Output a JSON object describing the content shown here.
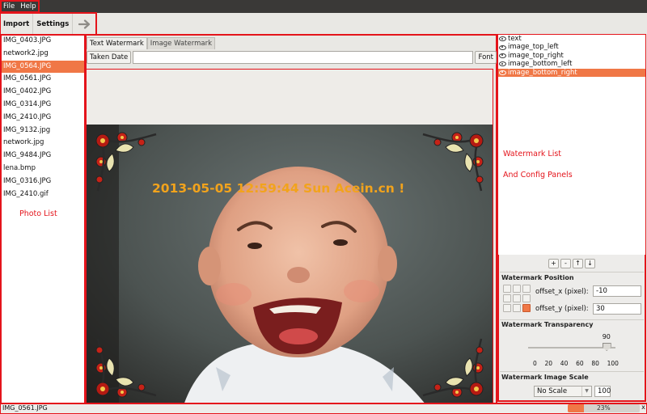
{
  "menubar": {
    "file": "File",
    "help": "Help"
  },
  "toolbar": {
    "import": "Import",
    "settings": "Settings",
    "next_icon": "arrow-right-icon"
  },
  "photo_list": {
    "items": [
      "IMG_0403.JPG",
      "network2.jpg",
      "IMG_0564.JPG",
      "IMG_0561.JPG",
      "IMG_0402.JPG",
      "IMG_0314.JPG",
      "IMG_2410.JPG",
      "IMG_9132.jpg",
      "network.jpg",
      "IMG_9484.JPG",
      "lena.bmp",
      "IMG_0316.JPG",
      "IMG_2410.gif"
    ],
    "selected_index": 2,
    "annotation": "Photo List"
  },
  "editor": {
    "tabs": [
      "Text Watermark",
      "Image Watermark"
    ],
    "active_tab": 0,
    "taken_date_button": "Taken Date",
    "text_value": "",
    "font_button": "Font",
    "watermark_text": "2013-05-05 12:59:44 Sun Acein.cn !",
    "watermark_color": "#f2a31c"
  },
  "watermark_list": {
    "items": [
      "text",
      "image_top_left",
      "image_top_right",
      "image_bottom_left",
      "image_bottom_right"
    ],
    "selected_index": 4,
    "annotation_line1": "Watermark List",
    "annotation_line2": "And Config Panels",
    "buttons": [
      "+",
      "-",
      "↑",
      "↓"
    ]
  },
  "position": {
    "title": "Watermark Position",
    "offset_x_label": "offset_x (pixel):",
    "offset_x_value": "-10",
    "offset_y_label": "offset_y (pixel):",
    "offset_y_value": "30",
    "selected_cell": 8
  },
  "transparency": {
    "title": "Watermark Transparency",
    "value": 90,
    "ticks": [
      "0",
      "20",
      "40",
      "60",
      "80",
      "100"
    ]
  },
  "scale": {
    "title": "Watermark Image Scale",
    "mode": "No Scale",
    "value": "100"
  },
  "status": {
    "file": "IMG_0561.JPG",
    "progress": 23,
    "progress_label": "23%",
    "close": "x"
  },
  "colors": {
    "accent": "#f07746",
    "annotation": "#e4141b",
    "menubar": "#3a3937"
  }
}
